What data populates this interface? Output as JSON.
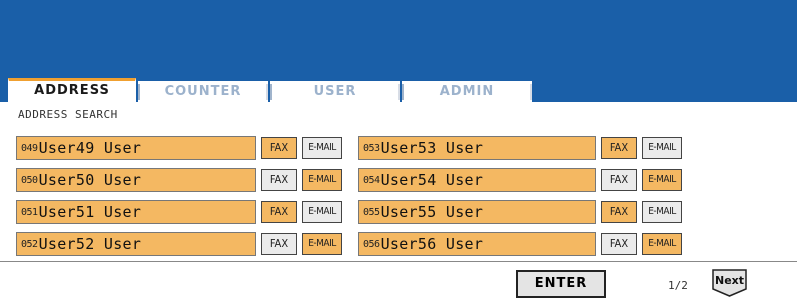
{
  "tabs": [
    {
      "label": "ADDRESS",
      "active": true
    },
    {
      "label": "COUNTER",
      "active": false
    },
    {
      "label": "USER",
      "active": false
    },
    {
      "label": "ADMIN",
      "active": false
    }
  ],
  "subtitle": "ADDRESS SEARCH",
  "entries": [
    {
      "num": "049",
      "name": "User49 User",
      "fax": "FAX",
      "email": "E-MAIL",
      "fax_selected": true,
      "email_selected": false
    },
    {
      "num": "050",
      "name": "User50 User",
      "fax": "FAX",
      "email": "E-MAIL",
      "fax_selected": false,
      "email_selected": true
    },
    {
      "num": "051",
      "name": "User51 User",
      "fax": "FAX",
      "email": "E-MAIL",
      "fax_selected": true,
      "email_selected": false
    },
    {
      "num": "052",
      "name": "User52 User",
      "fax": "FAX",
      "email": "E-MAIL",
      "fax_selected": false,
      "email_selected": true
    },
    {
      "num": "053",
      "name": "User53 User",
      "fax": "FAX",
      "email": "E-MAIL",
      "fax_selected": true,
      "email_selected": false
    },
    {
      "num": "054",
      "name": "User54 User",
      "fax": "FAX",
      "email": "E-MAIL",
      "fax_selected": false,
      "email_selected": true
    },
    {
      "num": "055",
      "name": "User55 User",
      "fax": "FAX",
      "email": "E-MAIL",
      "fax_selected": true,
      "email_selected": false
    },
    {
      "num": "056",
      "name": "User56 User",
      "fax": "FAX",
      "email": "E-MAIL",
      "fax_selected": false,
      "email_selected": true
    }
  ],
  "footer": {
    "enter_label": "ENTER",
    "page_info": "1/2",
    "next_label": "Next"
  },
  "colors": {
    "banner": "#1a5fa8",
    "selected": "#f4b862",
    "unselected": "#ebebeb",
    "active_tab_accent": "#f0a030"
  }
}
